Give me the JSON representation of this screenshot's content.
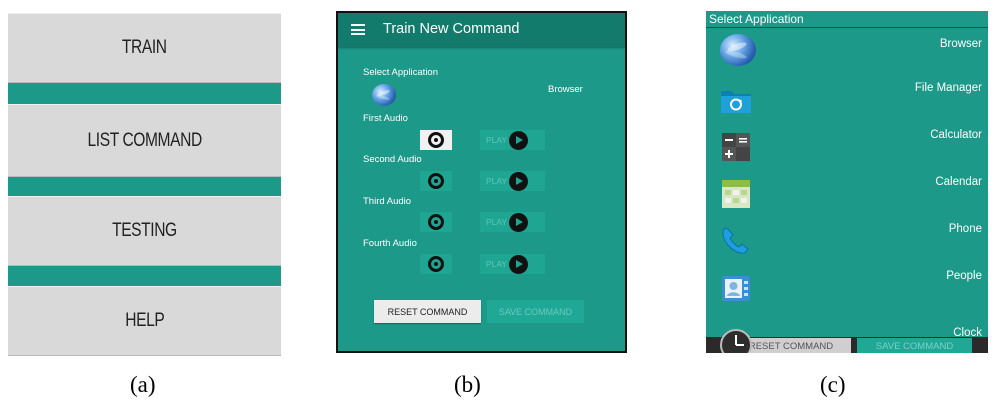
{
  "panel_a": {
    "buttons": [
      "TRAIN",
      "LIST COMMAND",
      "TESTING",
      "HELP"
    ]
  },
  "panel_b": {
    "title": "Train New Command",
    "select_application_label": "Select Application",
    "selected_app": "Browser",
    "audio_labels": [
      "First Audio",
      "Second Audio",
      "Third Audio",
      "Fourth Audio"
    ],
    "play_label": "PLAY",
    "reset_label": "RESET COMMAND",
    "save_label": "SAVE COMMAND"
  },
  "panel_c": {
    "title": "Select Application",
    "apps": [
      {
        "name": "Browser",
        "icon": "globe-icon"
      },
      {
        "name": "File Manager",
        "icon": "folder-icon"
      },
      {
        "name": "Calculator",
        "icon": "calculator-icon"
      },
      {
        "name": "Calendar",
        "icon": "calendar-icon"
      },
      {
        "name": "Phone",
        "icon": "phone-icon"
      },
      {
        "name": "People",
        "icon": "contacts-icon"
      },
      {
        "name": "Clock",
        "icon": "clock-icon"
      }
    ],
    "reset_ghost": "RESET COMMAND",
    "save_ghost": "SAVE COMMAND"
  },
  "captions": [
    "(a)",
    "(b)",
    "(c)"
  ],
  "colors": {
    "teal": "#1d9989",
    "header_teal": "#137b6c",
    "button_gray": "#d9d9d9"
  }
}
